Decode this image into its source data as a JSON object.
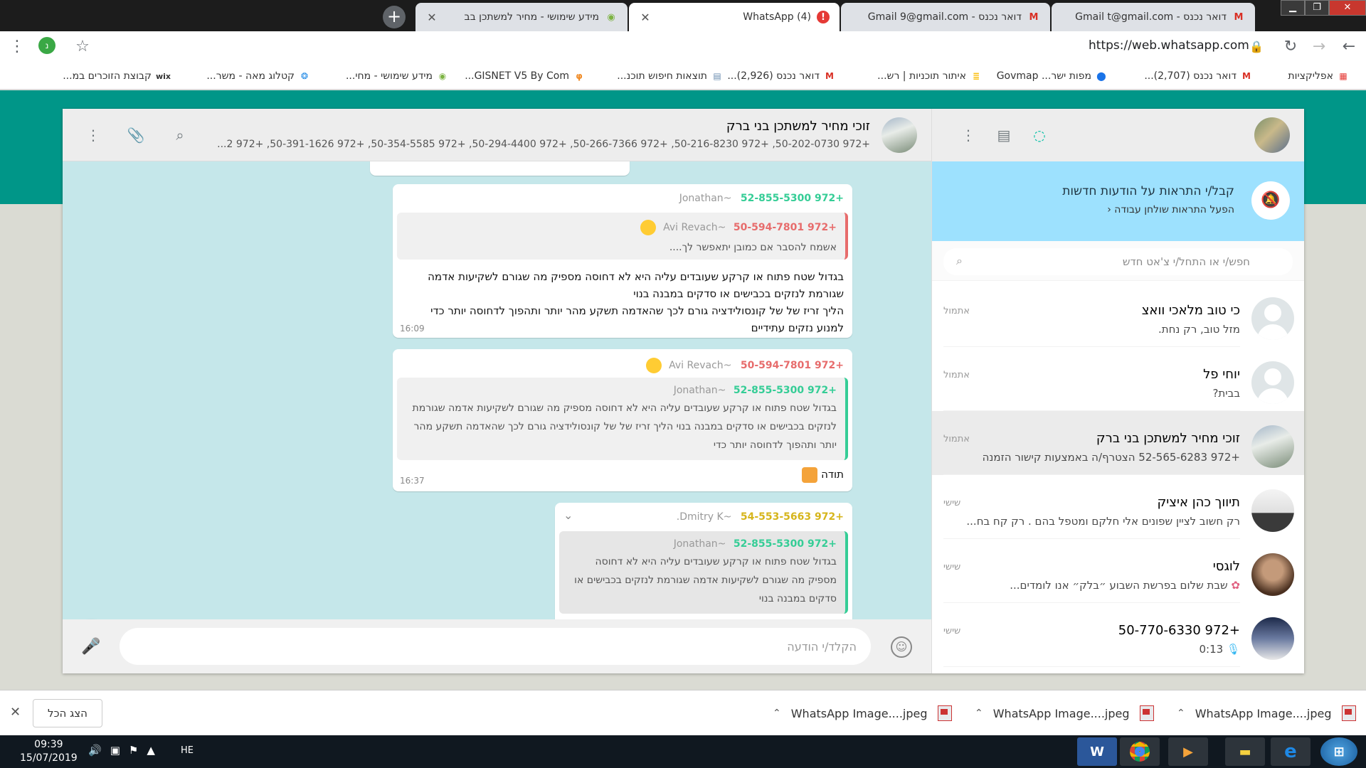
{
  "browser": {
    "tabs": [
      {
        "title": "דואר נכנס - Gmail  t@gmail.com",
        "icon": "gmail-icon",
        "active": false
      },
      {
        "title": "דואר נכנס - Gmail  9@gmail.com",
        "icon": "gmail-icon",
        "active": false
      },
      {
        "title": "(4) WhatsApp",
        "icon": "alert-icon",
        "active": true
      },
      {
        "title": "מידע שימושי - מחיר למשתכן בב",
        "icon": "green-badge-icon",
        "active": false
      }
    ],
    "url": "https://web.whatsapp.com",
    "profile_initial": "נ",
    "bookmarks": [
      "אפליקציות",
      "דואר נכנס (2,707)...",
      "מפות ישר... Govmap",
      "איתור תוכניות | רש...",
      "דואר נכנס (2,926)...",
      "תוצאות חיפוש תוכנ...",
      "GISNET V5 By Com...",
      "מידע שימושי - מחי...",
      "קטלוג מאה - משר...",
      "wix",
      "קבוצת הזוכרים במ..."
    ]
  },
  "sidebar": {
    "notification": {
      "title": "קבל/י התראות על הודעות חדשות",
      "link": "הפעל התראות שולחן עבודה ‹"
    },
    "search_placeholder": "חפש/י או התחל/י צ'אט חדש",
    "chats": [
      {
        "name": "כי טוב מלאכי וואצ",
        "time": "אתמול",
        "preview": "מזל טוב, רק נחת.",
        "avatar": "blank"
      },
      {
        "name": "יוחי פל",
        "time": "אתמול",
        "preview": "בבית?",
        "avatar": "blank"
      },
      {
        "name": "זוכי מחיר למשתכן בני ברק",
        "time": "אתמול",
        "preview": "+972 52-565-6283 הצטרף/ה באמצעות קישור הזמנה",
        "avatar": "group",
        "selected": true
      },
      {
        "name": "תיווך כהן איציק",
        "time": "שישי",
        "preview": "רק חשוב לציין שפונים אלי חלקם ומטפל בהם . רק קח בח...",
        "avatar": "person"
      },
      {
        "name": "לוגסי",
        "time": "שישי",
        "preview": "שבת שלום  בפרשת השבוע ״בלק״ אנו לומדים...",
        "avatar": "person2"
      },
      {
        "name": "+972 50-770-6330",
        "time": "שישי",
        "preview": "0:13",
        "avatar": "group2"
      }
    ]
  },
  "chat": {
    "title": "זוכי מחיר למשתכן בני ברק",
    "members": "+972 50-202-0730, +972 50-216-8230, +972 50-266-7366, +972 50-294-4400, +972 50-354-5585, +972 50-391-1626, +972 2...",
    "compose_placeholder": "הקלד/י הודעה",
    "messages": [
      {
        "sender_phone": "+972 52-855-5300",
        "sender_name": "~Jonathan",
        "sender_color": "#35cd96",
        "quote_phone": "+972 50-594-7801",
        "quote_name": "~Avi Revach",
        "quote_color": "#e76c6c",
        "quote_text": "אשמח להסבר אם כמובן יתאפשר לך....",
        "text1": "בגדול שטח פתוח או קרקע שעובדים עליה היא לא דחוסה מספיק מה שגורם לשקיעות אדמה שגורמת לנזקים בכבישים או סדקים במבנה בנוי",
        "text2": "הליך זריז של של קונסולידציה גורם לכך שהאדמה תשקע מהר יותר ותהפוך לדחוסה יותר כדי למנוע נזקים עתידיים",
        "time": "16:09"
      },
      {
        "sender_phone": "+972 50-594-7801",
        "sender_name": "~Avi Revach",
        "sender_color": "#e76c6c",
        "quote_phone": "+972 52-855-5300",
        "quote_name": "~Jonathan",
        "quote_color": "#35cd96",
        "quote_text": "בגדול שטח פתוח או קרקע שעובדים עליה היא לא דחוסה מספיק מה שגורם לשקיעות אדמה שגורמת לנזקים בכבישים או סדקים במבנה בנוי הליך זריז של של קונסולידציה גורם לכך שהאדמה תשקע מהר יותר ותהפוך לדחוסה יותר כדי",
        "text1": "תודה",
        "time": "16:37"
      },
      {
        "sender_phone": "+972 54-553-5663",
        "sender_name": "~Dmitry K.",
        "sender_color": "#d6b51c",
        "quote_phone": "+972 52-855-5300",
        "quote_name": "~Jonathan",
        "quote_color": "#35cd96",
        "quote_text": "בגדול שטח פתוח או קרקע שעובדים עליה היא לא דחוסה מספיק מה שגורם לשקיעות אדמה שגורמת לנזקים בכבישים או סדקים במבנה בנוי"
      }
    ]
  },
  "downloads": {
    "show_all": "הצג הכל",
    "items": [
      "WhatsApp Image....jpeg",
      "WhatsApp Image....jpeg",
      "WhatsApp Image....jpeg"
    ]
  },
  "taskbar": {
    "time": "09:39",
    "date": "15/07/2019",
    "lang": "HE"
  }
}
